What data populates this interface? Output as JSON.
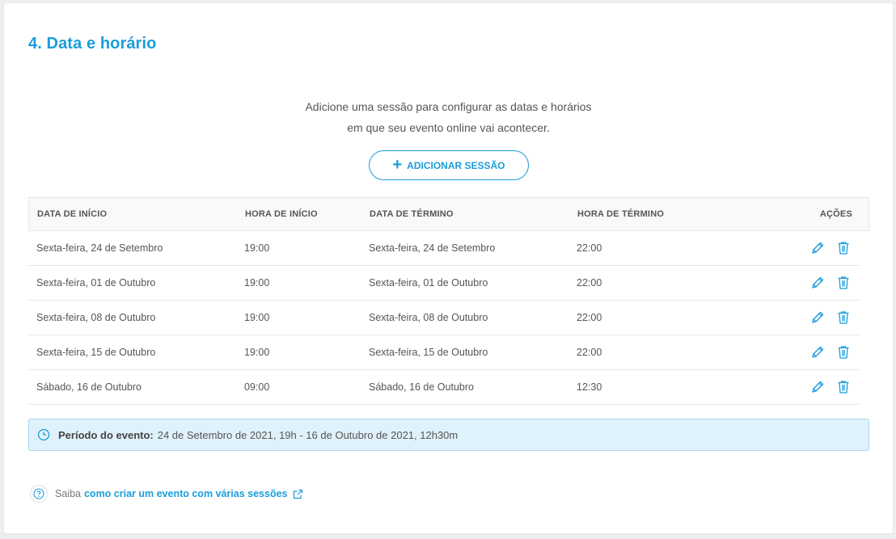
{
  "section": {
    "title": "4. Data e horário",
    "intro_line1": "Adicione uma sessão para configurar as datas e horários",
    "intro_line2": "em que seu evento online vai acontecer.",
    "add_button": "ADICIONAR SESSÃO"
  },
  "table": {
    "headers": {
      "start_date": "DATA DE INÍCIO",
      "start_time": "HORA DE INÍCIO",
      "end_date": "DATA DE TÉRMINO",
      "end_time": "HORA DE TÉRMINO",
      "actions": "AÇÕES"
    },
    "rows": [
      {
        "start_date": "Sexta-feira, 24 de Setembro",
        "start_time": "19:00",
        "end_date": "Sexta-feira, 24 de Setembro",
        "end_time": "22:00"
      },
      {
        "start_date": "Sexta-feira, 01 de Outubro",
        "start_time": "19:00",
        "end_date": "Sexta-feira, 01 de Outubro",
        "end_time": "22:00"
      },
      {
        "start_date": "Sexta-feira, 08 de Outubro",
        "start_time": "19:00",
        "end_date": "Sexta-feira, 08 de Outubro",
        "end_time": "22:00"
      },
      {
        "start_date": "Sexta-feira, 15 de Outubro",
        "start_time": "19:00",
        "end_date": "Sexta-feira, 15 de Outubro",
        "end_time": "22:00"
      },
      {
        "start_date": "Sábado, 16 de Outubro",
        "start_time": "09:00",
        "end_date": "Sábado, 16 de Outubro",
        "end_time": "12:30"
      }
    ],
    "row_action_icons": [
      "pencil-icon",
      "trash-icon"
    ]
  },
  "period": {
    "label": "Período do evento:",
    "value": "24 de Setembro de 2021, 19h - 16 de Outubro de 2021, 12h30m",
    "icon": "clock-icon"
  },
  "help": {
    "prefix": "Saiba",
    "link": "como criar um evento com várias sessões",
    "icon": "question-circle-icon",
    "link_icon": "external-link-icon"
  },
  "colors": {
    "accent": "#1a9ddc",
    "info_bg": "#dff1fb",
    "info_border": "#a9d8f0"
  }
}
